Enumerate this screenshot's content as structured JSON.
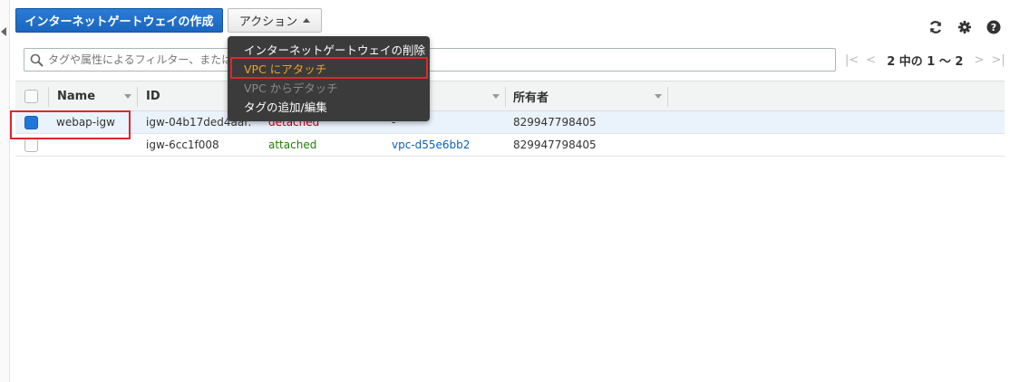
{
  "toolbar": {
    "create_label": "インターネットゲートウェイの作成",
    "actions_label": "アクション"
  },
  "icons": {
    "refresh": "refresh-icon",
    "settings": "gear-icon",
    "help": "help-icon",
    "search": "search-icon"
  },
  "filter": {
    "placeholder": "タグや属性によるフィルター、または"
  },
  "pager": {
    "info": "2 中の 1 ～ 2"
  },
  "table": {
    "headers": {
      "name": "Name",
      "id": "ID",
      "owner": "所有者"
    },
    "rows": [
      {
        "name": "webap-igw",
        "id": "igw-04b17ded4aaf…",
        "state": "detached",
        "vpc": "-",
        "owner": "829947798405",
        "selected": true
      },
      {
        "name": "",
        "id": "igw-6cc1f008",
        "state": "attached",
        "vpc": "vpc-d55e6bb2",
        "owner": "829947798405",
        "selected": false
      }
    ]
  },
  "menu": {
    "items": [
      {
        "label": "インターネットゲートウェイの削除",
        "state": "normal"
      },
      {
        "label": "VPC にアタッチ",
        "state": "highlighted"
      },
      {
        "label": "VPC からデタッチ",
        "state": "disabled"
      },
      {
        "label": "タグの追加/編集",
        "state": "normal"
      }
    ]
  },
  "colors": {
    "primary": "#1a66c0",
    "highlight": "#f0a12a",
    "detached": "#d0021b",
    "attached": "#1d8102",
    "link": "#0b61b8",
    "annotation": "#e0262c"
  }
}
